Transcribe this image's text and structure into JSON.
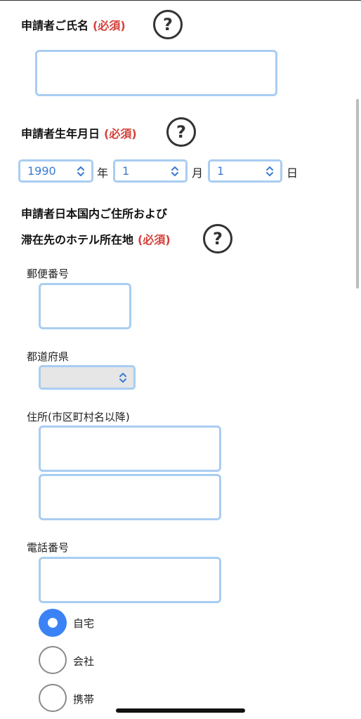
{
  "name_section": {
    "label": "申請者ご氏名",
    "required": "(必須)",
    "help": "?",
    "value": ""
  },
  "birth_section": {
    "label": "申請者生年月日",
    "required": "(必須)",
    "help": "?",
    "year": "1990",
    "year_unit": "年",
    "month": "1",
    "month_unit": "月",
    "day": "1",
    "day_unit": "日"
  },
  "address_section": {
    "label_line1": "申請者日本国内ご住所および",
    "label_line2": "滞在先のホテル所在地",
    "required": "(必須)",
    "help": "?",
    "postal_label": "郵便番号",
    "postal_value": "",
    "prefecture_label": "都道府県",
    "prefecture_value": "",
    "address_label": "住所(市区町村名以降)",
    "address_line1": "",
    "address_line2": ""
  },
  "phone_section": {
    "label": "電話番号",
    "value": "",
    "options": [
      {
        "label": "自宅",
        "checked": true
      },
      {
        "label": "会社",
        "checked": false
      },
      {
        "label": "携帯",
        "checked": false
      }
    ]
  },
  "colors": {
    "accent": "#3b82f6",
    "field_border": "#a9cdf2",
    "required": "#d5413a"
  }
}
